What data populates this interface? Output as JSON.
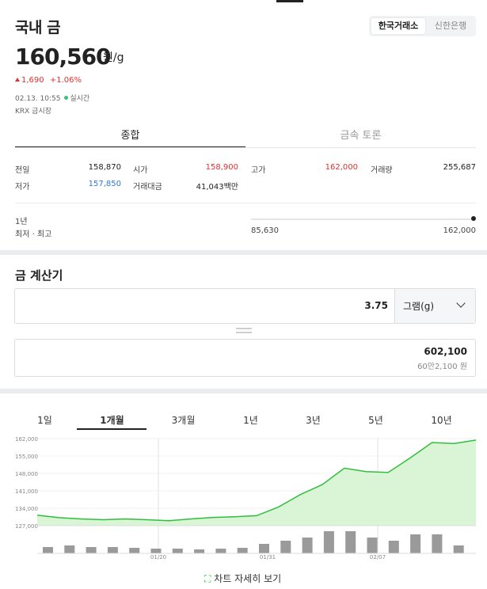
{
  "header": {
    "title": "국내 금",
    "sources": [
      "한국거래소",
      "신한은행"
    ]
  },
  "price": {
    "value": "160,560",
    "unit": "원/g",
    "change": "1,690",
    "change_pct": "+1.06%",
    "timestamp": "02.13. 10:55",
    "realtime_label": "실시간",
    "market": "KRX 금시장"
  },
  "tabs": [
    "종합",
    "금속 토론"
  ],
  "stats": {
    "prev_close_label": "전일",
    "prev_close": "158,870",
    "open_label": "시가",
    "open": "158,900",
    "high_label": "고가",
    "high": "162,000",
    "volume_label": "거래량",
    "volume": "255,687",
    "low_label": "저가",
    "low": "157,850",
    "amount_label": "거래대금",
    "amount": "41,043백만"
  },
  "range52": {
    "period": "1년",
    "label": "최저 · 최고",
    "low": "85,630",
    "high": "162,000",
    "position": 1.0
  },
  "calculator": {
    "title": "금 계산기",
    "input_value": "3.75",
    "unit_select": "그램(g)",
    "result": "602,100",
    "result_sub": "60만2,100 원"
  },
  "period_tabs": [
    "1일",
    "1개월",
    "3개월",
    "1년",
    "3년",
    "5년",
    "10년"
  ],
  "active_period": "1개월",
  "more_label": "차트 자세히 보기",
  "colors": {
    "up": "#e2302d",
    "down": "#2b7bd8",
    "chart_line": "#2fbf3d",
    "chart_fill": "#d9f5d6",
    "volume_bar": "#9a9a9a"
  },
  "chart_data": {
    "type": "area",
    "y_ticks": [
      "162,000",
      "155,000",
      "148,000",
      "141,000",
      "134,000",
      "127,000"
    ],
    "ylim": [
      127000,
      162000
    ],
    "x_labels": [
      "01/20",
      "01/31",
      "02/07"
    ],
    "series": [
      {
        "values": [
          131200,
          130200,
          129700,
          129400,
          129700,
          129400,
          129000,
          129700,
          130300,
          130600,
          131000,
          134500,
          139500,
          143500,
          150100,
          148700,
          148400,
          154200,
          160400,
          160000,
          161400
        ]
      }
    ],
    "volume": [
      4,
      5,
      4,
      4,
      3.5,
      3,
      3,
      2.5,
      3,
      3.5,
      6,
      8,
      10,
      14,
      14,
      10,
      8,
      12,
      12,
      5
    ]
  }
}
